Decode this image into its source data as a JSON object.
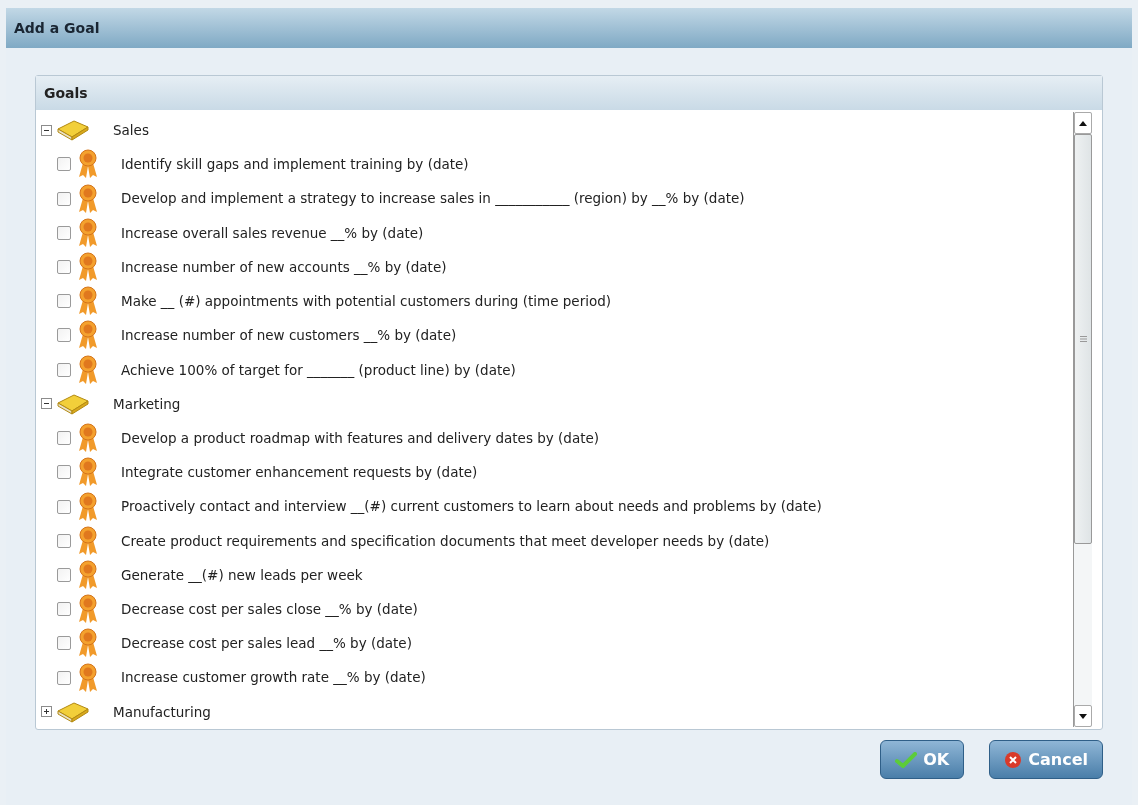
{
  "window": {
    "title": "Add a Goal"
  },
  "panel": {
    "title": "Goals"
  },
  "groups": [
    {
      "label": "Sales",
      "expanded": true,
      "goals": [
        {
          "text": "Identify skill gaps and implement training by (date)",
          "checked": false
        },
        {
          "text": "Develop and implement a strategy to increase sales in ___________ (region) by __% by (date)",
          "checked": false
        },
        {
          "text": "Increase overall sales revenue __% by (date)",
          "checked": false
        },
        {
          "text": "Increase number of new accounts __% by (date)",
          "checked": false
        },
        {
          "text": "Make __ (#) appointments with potential customers during (time period)",
          "checked": false
        },
        {
          "text": "Increase number of new customers __% by (date)",
          "checked": false
        },
        {
          "text": "Achieve 100% of target for _______ (product line) by (date)",
          "checked": false
        }
      ]
    },
    {
      "label": "Marketing",
      "expanded": true,
      "goals": [
        {
          "text": "Develop a product roadmap with features and delivery dates by (date)",
          "checked": false
        },
        {
          "text": "Integrate customer enhancement requests by (date)",
          "checked": false
        },
        {
          "text": "Proactively contact and interview __(#) current customers to learn about needs and problems by (date)",
          "checked": false
        },
        {
          "text": "Create product requirements and specification documents that meet developer needs by (date)",
          "checked": false
        },
        {
          "text": "Generate __(#) new leads per week",
          "checked": false
        },
        {
          "text": "Decrease cost per sales close __% by (date)",
          "checked": false
        },
        {
          "text": "Decrease cost per sales lead __% by (date)",
          "checked": false
        },
        {
          "text": "Increase customer growth rate __% by (date)",
          "checked": false
        }
      ]
    },
    {
      "label": "Manufacturing",
      "expanded": false
    }
  ],
  "buttons": [
    {
      "label": "OK",
      "kind": "ok"
    },
    {
      "label": "Cancel",
      "kind": "cancel"
    }
  ]
}
